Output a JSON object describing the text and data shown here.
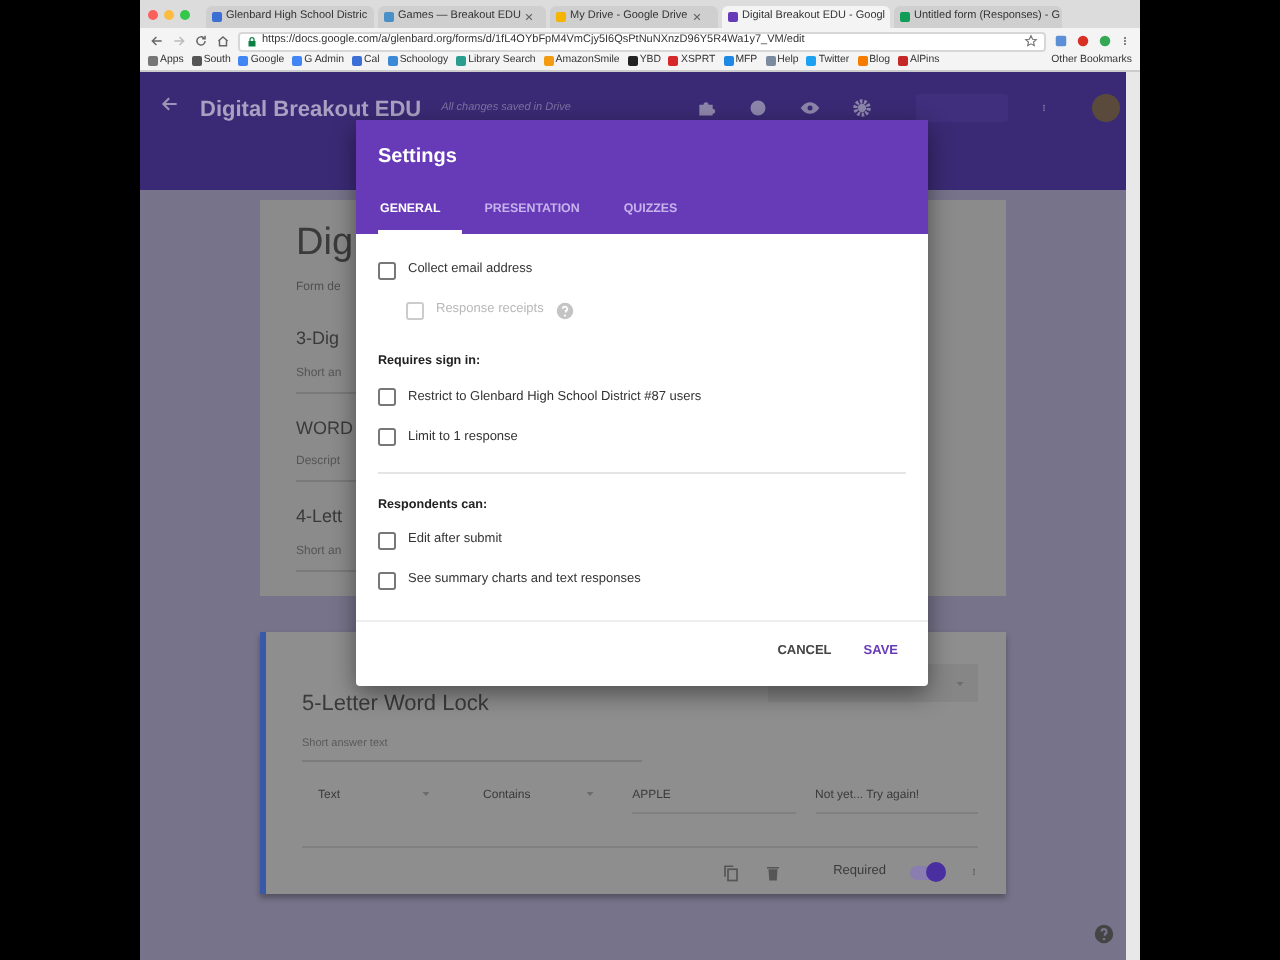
{
  "browser": {
    "tabs": [
      {
        "label": "Glenbard High School Distric",
        "selected": false,
        "color": "#3b6fd6"
      },
      {
        "label": "Games — Breakout EDU",
        "selected": false,
        "color": "#4a90c8"
      },
      {
        "label": "My Drive - Google Drive",
        "selected": false,
        "color": "#f4b400"
      },
      {
        "label": "Digital Breakout EDU - Googl",
        "selected": true,
        "color": "#673ab7"
      },
      {
        "label": "Untitled form (Responses) - G",
        "selected": false,
        "color": "#0f9d58"
      }
    ],
    "url": "https://docs.google.com/a/glenbard.org/forms/d/1fL4OYbFpM4VmCjy5I6QsPtNuNXnzD96Y5R4Wa1y7_VM/edit",
    "bookmarks": [
      {
        "label": "Apps",
        "color": "#777777"
      },
      {
        "label": "South",
        "color": "#555555"
      },
      {
        "label": "Google",
        "color": "#4285f4"
      },
      {
        "label": "G Admin",
        "color": "#4285f4"
      },
      {
        "label": "Cal",
        "color": "#3b6fd6"
      },
      {
        "label": "Schoology",
        "color": "#3b8ad6"
      },
      {
        "label": "Library Search",
        "color": "#2a9d8f"
      },
      {
        "label": "AmazonSmile",
        "color": "#f39c12"
      },
      {
        "label": "YBD",
        "color": "#222222"
      },
      {
        "label": "XSPRT",
        "color": "#d62828"
      },
      {
        "label": "MFP",
        "color": "#1e88e5"
      },
      {
        "label": "Help",
        "color": "#7a8aa0"
      },
      {
        "label": "Twitter",
        "color": "#1da1f2"
      },
      {
        "label": "Blog",
        "color": "#f57c00"
      },
      {
        "label": "AlPins",
        "color": "#c62828"
      }
    ],
    "other_bookmarks": "Other Bookmarks"
  },
  "app": {
    "title": "Digital Breakout EDU",
    "save_status": "All changes saved in Drive"
  },
  "form": {
    "title": "Dig",
    "description": "Form de",
    "questions": [
      {
        "title": "3-Dig",
        "hint": "Short an"
      },
      {
        "title": "WORD",
        "hint": "Descript"
      },
      {
        "title": "4-Lett",
        "hint": "Short an"
      }
    ]
  },
  "active_question": {
    "title": "5-Letter Word Lock",
    "hint": "Short answer text",
    "validation": [
      {
        "kind": "select",
        "value": "Text"
      },
      {
        "kind": "select",
        "value": "Contains"
      },
      {
        "kind": "input",
        "value": "APPLE"
      },
      {
        "kind": "input",
        "value": "Not yet... Try again!"
      }
    ],
    "required_label": "Required",
    "required": true
  },
  "dialog": {
    "title": "Settings",
    "tabs": [
      {
        "label": "GENERAL",
        "selected": true
      },
      {
        "label": "PRESENTATION",
        "selected": false
      },
      {
        "label": "QUIZZES",
        "selected": false
      }
    ],
    "items": [
      {
        "kind": "checkbox",
        "label": "Collect email address",
        "checked": false,
        "disabled": false,
        "children": [
          {
            "kind": "checkbox",
            "label": "Response receipts",
            "checked": false,
            "disabled": true,
            "help": true
          }
        ]
      },
      {
        "kind": "heading",
        "label": "Requires sign in:"
      },
      {
        "kind": "checkbox",
        "label": "Restrict to Glenbard High School District #87 users",
        "checked": false,
        "disabled": false
      },
      {
        "kind": "checkbox",
        "label": "Limit to 1 response",
        "checked": false,
        "disabled": false
      },
      {
        "kind": "divider"
      },
      {
        "kind": "heading",
        "label": "Respondents can:"
      },
      {
        "kind": "checkbox",
        "label": "Edit after submit",
        "checked": false,
        "disabled": false
      },
      {
        "kind": "checkbox",
        "label": "See summary charts and text responses",
        "checked": false,
        "disabled": false
      }
    ],
    "buttons": [
      {
        "label": "CANCEL",
        "primary": false
      },
      {
        "label": "SAVE",
        "primary": true
      }
    ]
  }
}
